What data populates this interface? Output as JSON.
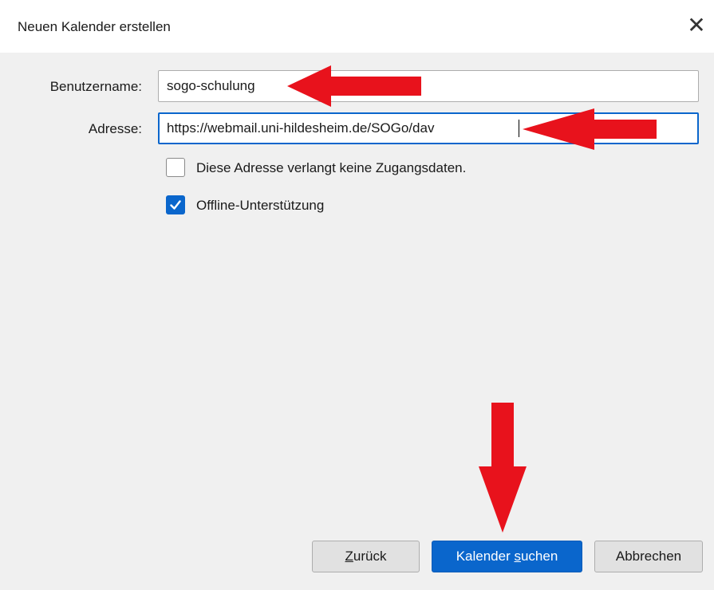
{
  "window": {
    "title": "Neuen Kalender erstellen",
    "close_glyph": "✕"
  },
  "form": {
    "username": {
      "label": "Benutzername:",
      "value": "sogo-schulung"
    },
    "address": {
      "label": "Adresse:",
      "value": "https://webmail.uni-hildesheim.de/SOGo/dav"
    },
    "no_credentials": {
      "label": "Diese Adresse verlangt keine Zugangsdaten.",
      "checked": false
    },
    "offline_support": {
      "label": "Offline-Unterstützung",
      "checked": true
    }
  },
  "buttons": {
    "back": {
      "prefix": "",
      "accesskey": "Z",
      "suffix": "urück"
    },
    "search": {
      "prefix": "Kalender ",
      "accesskey": "s",
      "suffix": "uchen"
    },
    "cancel": {
      "label": "Abbrechen"
    }
  },
  "colors": {
    "accent": "#0a66cc",
    "annotation_arrow": "#e8121c",
    "dialog_background": "#f0f0f0"
  },
  "icons": {
    "close": "close-icon",
    "checkmark": "checkmark-icon",
    "annotation": "red-arrow-annotation"
  }
}
